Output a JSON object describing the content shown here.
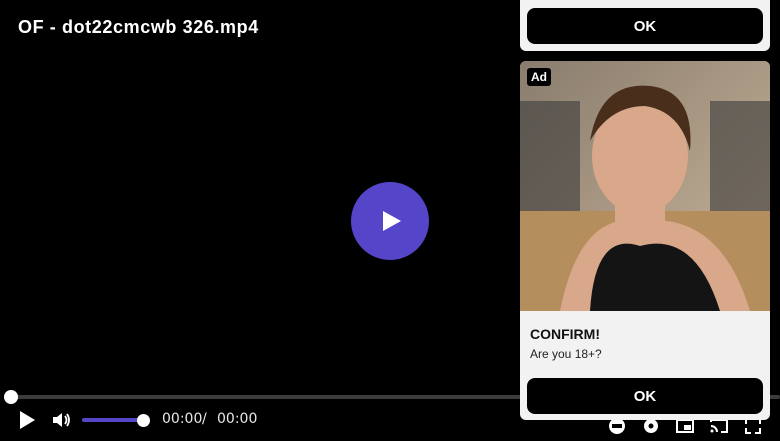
{
  "player": {
    "title": "OF - dot22cmcwb 326.mp4",
    "current_time": "00:00",
    "separator": "/",
    "duration": "00:00",
    "progress": 0,
    "volume": 1.0,
    "accent_color": "#5546c9"
  },
  "ad_top": {
    "ok_label": "OK"
  },
  "ad_card": {
    "badge": "Ad",
    "headline": "CONFIRM!",
    "subtext": "Are you 18+?",
    "ok_label": "OK"
  },
  "icons": [
    "play-icon",
    "volume-icon",
    "settings-icon",
    "chromecast-icon",
    "fullscreen-icon"
  ]
}
